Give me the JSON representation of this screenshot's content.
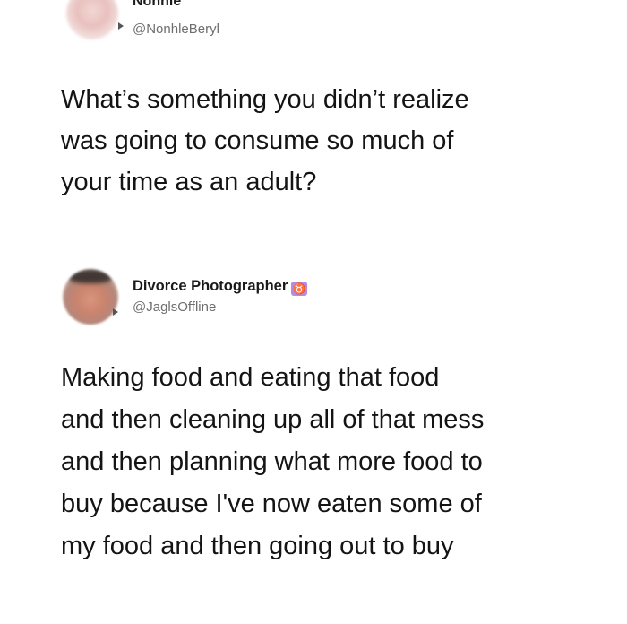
{
  "tweets": [
    {
      "author": {
        "display_name": "Nonhle",
        "handle": "@NonhleBeryl",
        "avatar_icon": "blurred-profile-photo"
      },
      "text_lines": [
        "What’s something you didn’t realize",
        "was going to consume so much of",
        "your time as an adult?"
      ]
    },
    {
      "author": {
        "display_name": "Divorce Photographer",
        "badge": "♉",
        "badge_icon": "zodiac-badge-icon",
        "handle": "@JaglsOffline",
        "avatar_icon": "blurred-profile-photo"
      },
      "text_lines": [
        "Making food and eating that food",
        "and then cleaning up all of that mess",
        "and then planning what more food to",
        "buy because I've now eaten some of",
        "my food and then going out to buy"
      ]
    }
  ],
  "colors": {
    "background": "#ffffff",
    "text": "#141414",
    "handle": "#6e6e6e",
    "badge": "#b48be0"
  }
}
